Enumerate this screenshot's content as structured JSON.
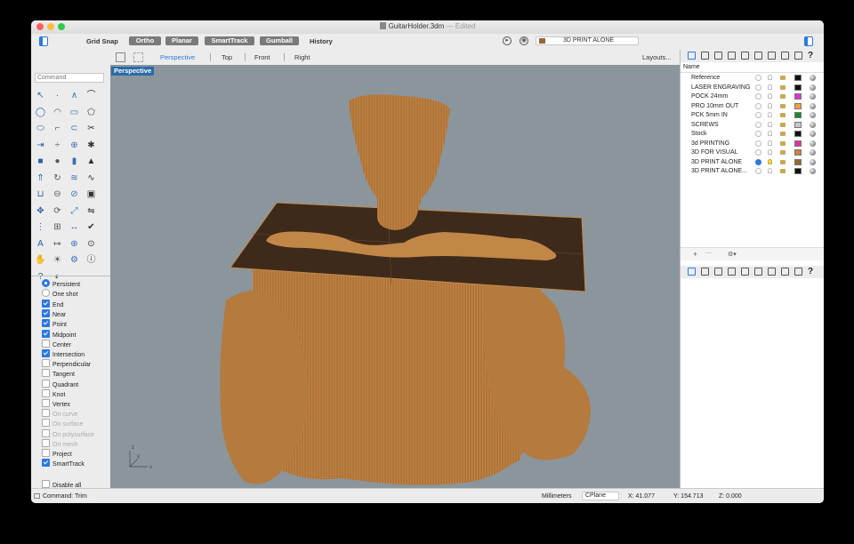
{
  "window": {
    "title": "GuitarHolder.3dm",
    "edited": "— Edited",
    "traffic_lights": {
      "close": "#fc605c",
      "minimize": "#fdbc40",
      "zoom": "#34c84a"
    }
  },
  "toolbar": {
    "grid_snap": "Grid Snap",
    "ortho": "Ortho",
    "planar": "Planar",
    "smarttrack": "SmartTrack",
    "gumball": "Gumball",
    "history": "History",
    "current_layer": {
      "label": "3D PRINT ALONE",
      "color": "#9a6733"
    }
  },
  "command": {
    "placeholder": "Command"
  },
  "viewport_tabs": {
    "items": [
      "Perspective",
      "Top",
      "Front",
      "Right"
    ],
    "active": "Perspective",
    "layouts": "Layouts..."
  },
  "viewport": {
    "label": "Perspective",
    "background": "#8b959c",
    "axis": {
      "x": "x",
      "y": "y",
      "z": "z"
    }
  },
  "osnaps": {
    "mode_options": [
      {
        "label": "Persistent",
        "selected": true
      },
      {
        "label": "One shot",
        "selected": false
      }
    ],
    "items": [
      {
        "label": "End",
        "checked": true,
        "enabled": true
      },
      {
        "label": "Near",
        "checked": true,
        "enabled": true
      },
      {
        "label": "Point",
        "checked": true,
        "enabled": true
      },
      {
        "label": "Midpoint",
        "checked": true,
        "enabled": true
      },
      {
        "label": "Center",
        "checked": false,
        "enabled": true
      },
      {
        "label": "Intersection",
        "checked": true,
        "enabled": true
      },
      {
        "label": "Perpendicular",
        "checked": false,
        "enabled": true
      },
      {
        "label": "Tangent",
        "checked": false,
        "enabled": true
      },
      {
        "label": "Quadrant",
        "checked": false,
        "enabled": true
      },
      {
        "label": "Knot",
        "checked": false,
        "enabled": true
      },
      {
        "label": "Vertex",
        "checked": false,
        "enabled": true
      },
      {
        "label": "On curve",
        "checked": false,
        "enabled": false
      },
      {
        "label": "On surface",
        "checked": false,
        "enabled": false
      },
      {
        "label": "On polysurface",
        "checked": false,
        "enabled": false
      },
      {
        "label": "On mesh",
        "checked": false,
        "enabled": false
      },
      {
        "label": "Project",
        "checked": false,
        "enabled": true
      },
      {
        "label": "SmartTrack",
        "checked": true,
        "enabled": true
      }
    ],
    "disable_all": {
      "label": "Disable all",
      "checked": false
    }
  },
  "layers": {
    "header": "Name",
    "items": [
      {
        "name": "Reference",
        "current": false,
        "on": false,
        "color": "#111111",
        "material": "#bbbbbb"
      },
      {
        "name": "LASER ENGRAVING",
        "current": false,
        "on": false,
        "color": "#111111",
        "material": "#555555"
      },
      {
        "name": "POCK 24mm",
        "current": false,
        "on": false,
        "color": "#e033d6",
        "material": "#555555"
      },
      {
        "name": "PRO 10mm OUT",
        "current": false,
        "on": false,
        "color": "#f0a03a",
        "material": "#555555"
      },
      {
        "name": "PCK 5mm IN",
        "current": false,
        "on": false,
        "color": "#1a8a2a",
        "material": "#555555"
      },
      {
        "name": "SCREWS",
        "current": false,
        "on": false,
        "color": "#c8c8c8",
        "material": "#555555"
      },
      {
        "name": "Stock",
        "current": false,
        "on": false,
        "color": "#111111",
        "material": "#555555"
      },
      {
        "name": "3d PRINTING",
        "current": false,
        "on": false,
        "color": "#e033a0",
        "material": "#555555"
      },
      {
        "name": "3D FOR VISUAL",
        "current": false,
        "on": false,
        "color": "#c8843a",
        "material": "#555555"
      },
      {
        "name": "3D PRINT ALONE",
        "current": true,
        "on": true,
        "color": "#9a6733",
        "material": "#555555"
      },
      {
        "name": "3D PRINT ALONE...",
        "current": false,
        "on": false,
        "color": "#111111",
        "material": "#555555"
      }
    ],
    "add": "+",
    "remove": "—"
  },
  "status": {
    "command": "Command: Trim",
    "units": "Millimeters",
    "cplane": "CPlane",
    "x": "X: 41.077",
    "y": "Y: 154.713",
    "z": "Z: 0.000"
  }
}
